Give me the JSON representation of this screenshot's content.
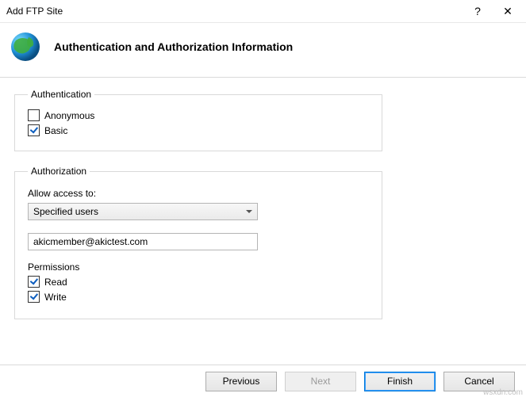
{
  "window": {
    "title": "Add FTP Site",
    "help": "?",
    "close": "✕"
  },
  "header": {
    "heading": "Authentication and Authorization Information"
  },
  "auth": {
    "legend": "Authentication",
    "anonymous": "Anonymous",
    "basic": "Basic"
  },
  "authorization": {
    "legend": "Authorization",
    "allow_label": "Allow access to:",
    "dropdown_value": "Specified users",
    "user_value": "akicmember@akictest.com",
    "permissions_label": "Permissions",
    "read": "Read",
    "write": "Write"
  },
  "footer": {
    "previous": "Previous",
    "next": "Next",
    "finish": "Finish",
    "cancel": "Cancel"
  },
  "watermark": "wsxdn.com"
}
